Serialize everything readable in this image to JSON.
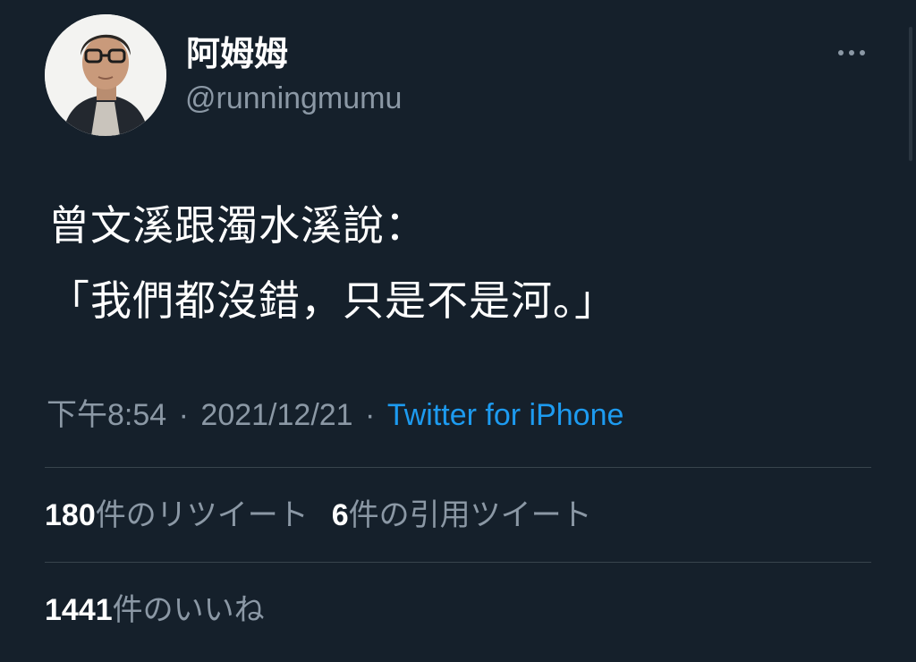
{
  "author": {
    "display_name": "阿姆姆",
    "handle": "@runningmumu"
  },
  "icons": {
    "more": "more-horizontal-icon"
  },
  "tweet": {
    "line1": "曾文溪跟濁水溪說：",
    "line2": "「我們都沒錯，只是不是河。」"
  },
  "meta": {
    "time": "下午8:54",
    "separator": "·",
    "date": "2021/12/21",
    "source": "Twitter for iPhone"
  },
  "stats": {
    "retweets": {
      "count": "180",
      "label": "件のリツイート"
    },
    "quotes": {
      "count": "6",
      "label": "件の引用ツイート"
    },
    "likes": {
      "count": "1441",
      "label": "件のいいね"
    }
  },
  "colors": {
    "background": "#15202b",
    "text_primary": "#ffffff",
    "text_secondary": "#8b98a5",
    "link": "#1d9bf0",
    "divider": "#38444d"
  }
}
